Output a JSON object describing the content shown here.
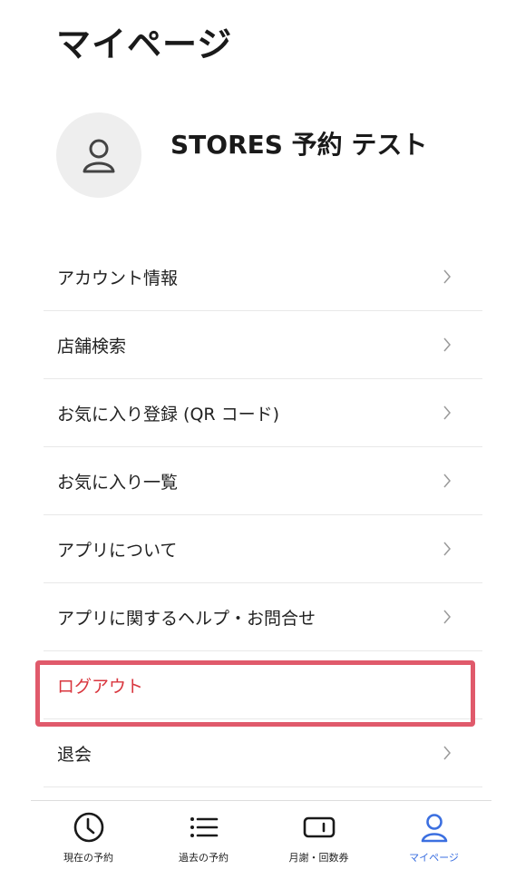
{
  "header": {
    "title": "マイページ"
  },
  "profile": {
    "name": "STORES 予約 テスト",
    "avatar_icon": "user-icon"
  },
  "menu": {
    "items": [
      {
        "label": "アカウント情報"
      },
      {
        "label": "店舗検索"
      },
      {
        "label": "お気に入り登録 (QR コード)"
      },
      {
        "label": "お気に入り一覧"
      },
      {
        "label": "アプリについて"
      },
      {
        "label": "アプリに関するヘルプ・お問合せ"
      },
      {
        "label": "ログアウト"
      },
      {
        "label": "退会"
      }
    ]
  },
  "tabbar": {
    "tabs": [
      {
        "label": "現在の予約",
        "icon": "clock-icon"
      },
      {
        "label": "過去の予約",
        "icon": "list-icon"
      },
      {
        "label": "月謝・回数券",
        "icon": "ticket-icon"
      },
      {
        "label": "マイページ",
        "icon": "user-icon",
        "active": true
      }
    ]
  },
  "colors": {
    "accent": "#3b6fe0",
    "danger_text": "#d9363e",
    "highlight_border": "#e05a6b"
  }
}
